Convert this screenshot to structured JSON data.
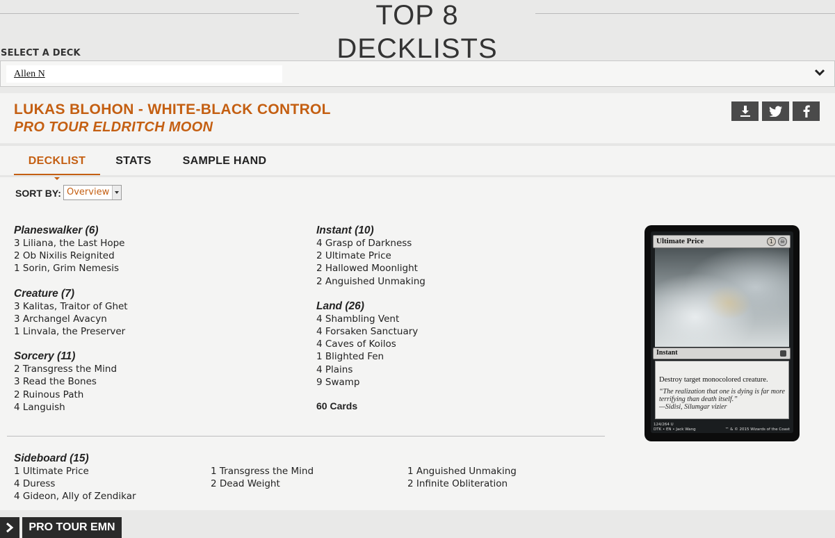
{
  "header": {
    "title": "TOP 8 DECKLISTS",
    "select_label": "SELECT A DECK",
    "selected_deck": "Allen N"
  },
  "deck": {
    "title": "LUKAS BLOHON - WHITE-BLACK CONTROL",
    "event": "PRO TOUR ELDRITCH MOON",
    "share_icons": [
      "download-icon",
      "twitter-icon",
      "facebook-icon"
    ]
  },
  "tabs": [
    "DECKLIST",
    "STATS",
    "SAMPLE HAND"
  ],
  "active_tab": "DECKLIST",
  "sort": {
    "label": "SORT BY:",
    "value": "Overview"
  },
  "left_groups": [
    {
      "title": "Planeswalker (6)",
      "cards": [
        "3 Liliana, the Last Hope",
        "2 Ob Nixilis Reignited",
        "1 Sorin, Grim Nemesis"
      ]
    },
    {
      "title": "Creature (7)",
      "cards": [
        "3 Kalitas, Traitor of Ghet",
        "3 Archangel Avacyn",
        "1 Linvala, the Preserver"
      ]
    },
    {
      "title": "Sorcery (11)",
      "cards": [
        "2 Transgress the Mind",
        "3 Read the Bones",
        "2 Ruinous Path",
        "4 Languish"
      ]
    }
  ],
  "right_groups": [
    {
      "title": "Instant (10)",
      "cards": [
        "4 Grasp of Darkness",
        "2 Ultimate Price",
        "2 Hallowed Moonlight",
        "2 Anguished Unmaking"
      ]
    },
    {
      "title": "Land (26)",
      "cards": [
        "4 Shambling Vent",
        "4 Forsaken Sanctuary",
        "4 Caves of Koilos",
        "1 Blighted Fen",
        "4 Plains",
        "9 Swamp"
      ]
    }
  ],
  "total": "60 Cards",
  "sideboard": {
    "title": "Sideboard (15)",
    "columns": [
      [
        "1 Ultimate Price",
        "4 Duress",
        "4 Gideon, Ally of Zendikar"
      ],
      [
        "1 Transgress the Mind",
        "2 Dead Weight"
      ],
      [
        "1 Anguished Unmaking",
        "2 Infinite Obliteration"
      ]
    ]
  },
  "card_preview": {
    "name": "Ultimate Price",
    "cost": "1",
    "type": "Instant",
    "rules": "Destroy target monocolored creature.",
    "flavor": "“The realization that one is dying is far more terrifying than death itself.”",
    "flavor_attribution": "—Sidisi, Silumgar vizier",
    "collector": "124/264 U",
    "set_line": "DTK • EN • Jack Wang",
    "copyright": "™ & © 2015 Wizards of the Coast"
  },
  "bottom_nav": {
    "label": "PRO TOUR EMN"
  },
  "colors": {
    "accent": "#c45f12",
    "dark_button": "#4a4a4a"
  }
}
